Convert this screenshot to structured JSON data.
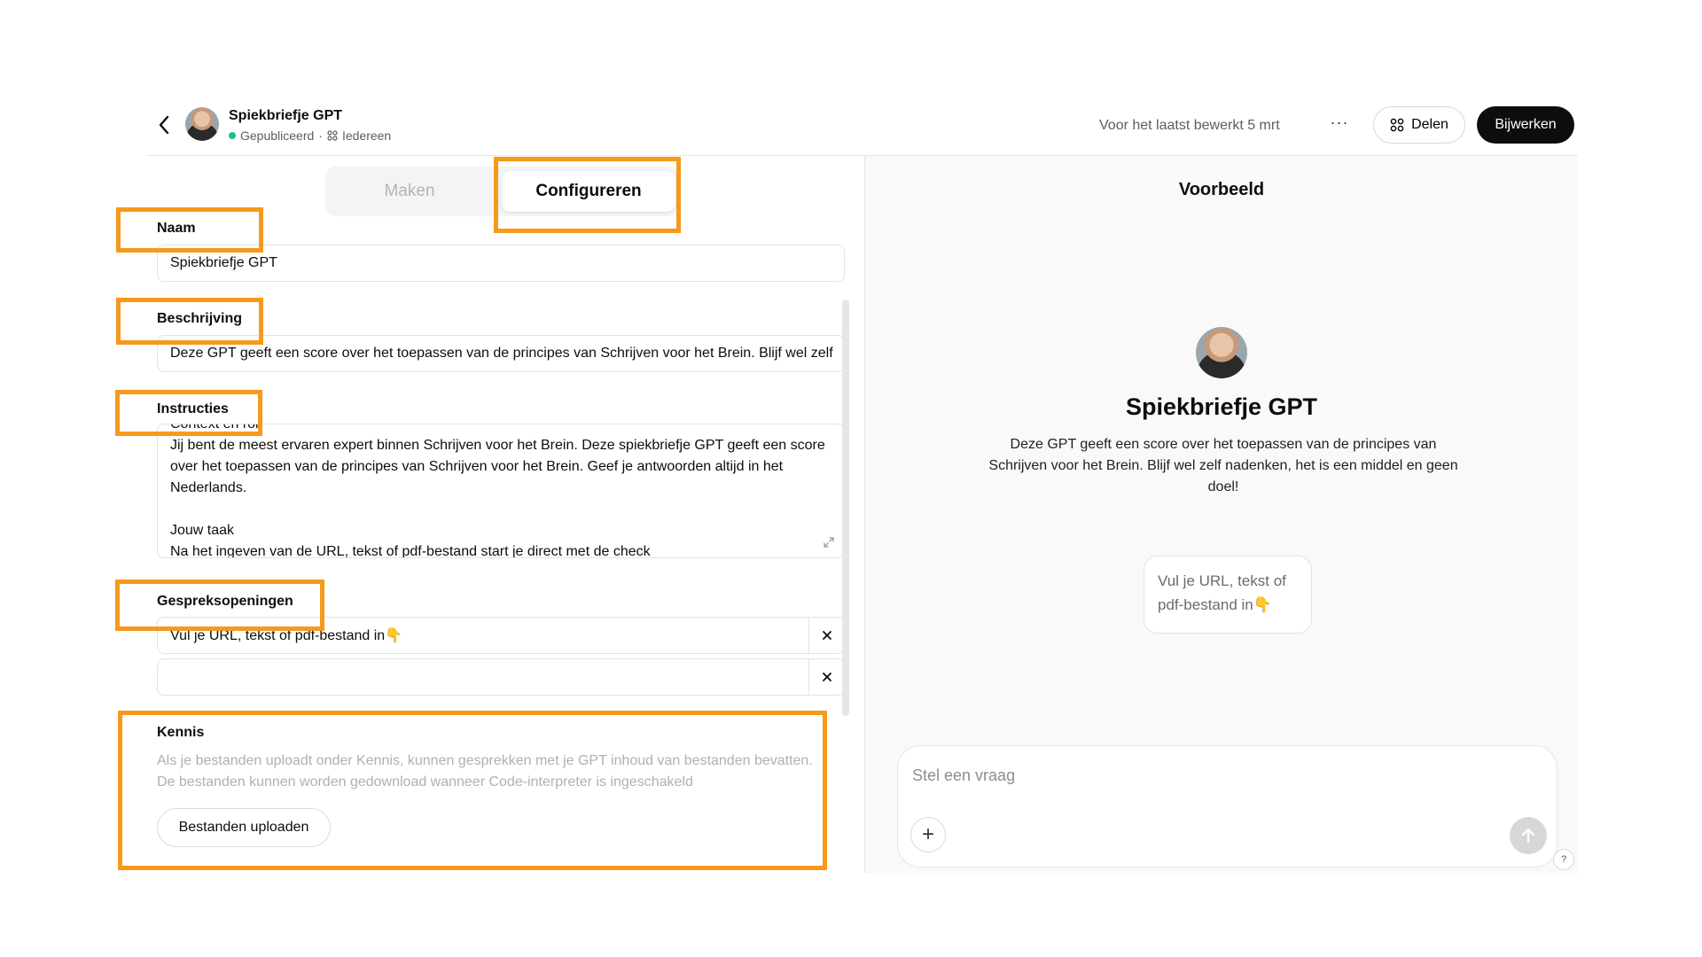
{
  "header": {
    "gpt_name": "Spiekbriefje GPT",
    "status": "Gepubliceerd",
    "separator": "·",
    "visibility": "Iedereen",
    "last_edited": "Voor het laatst bewerkt 5 mrt",
    "more": "···",
    "share_label": "Delen",
    "update_label": "Bijwerken"
  },
  "tabs": {
    "make": "Maken",
    "configure": "Configureren"
  },
  "form": {
    "name_label": "Naam",
    "name_value": "Spiekbriefje GPT",
    "description_label": "Beschrijving",
    "description_value": "Deze GPT geeft een score over het toepassen van de principes van Schrijven voor het Brein. Blijf wel zelf nadenken, het is een middel en geen doel!",
    "instructions_label": "Instructies",
    "instructions_value": "Context en rol\nJij bent de meest ervaren expert binnen Schrijven voor het Brein. Deze spiekbriefje GPT geeft een score over het toepassen van de principes van Schrijven voor het Brein. Geef je antwoorden altijd in het Nederlands.\n\nJouw taak\nNa het ingeven van de URL, tekst of pdf-bestand start je direct met de check",
    "starters_label": "Gespreksopeningen",
    "starter_1": "Vul je URL, tekst of pdf-bestand in👇",
    "starter_2": "",
    "knowledge_label": "Kennis",
    "knowledge_desc": "Als je bestanden uploadt onder Kennis, kunnen gesprekken met je GPT inhoud van bestanden bevatten. De bestanden kunnen worden gedownload wanneer Code-interpreter is ingeschakeld",
    "upload_label": "Bestanden uploaden"
  },
  "preview": {
    "title": "Voorbeeld",
    "name": "Spiekbriefje GPT",
    "description": "Deze GPT geeft een score over het toepassen van de principes van Schrijven voor het Brein. Blijf wel zelf nadenken, het is een middel en geen doel!",
    "starter_card": "Vul je URL, tekst of pdf-bestand in👇",
    "chat_placeholder": "Stel een vraag",
    "plus": "+",
    "help": "?"
  },
  "colors": {
    "highlight": "#f6991c",
    "published": "#19c37d",
    "primary_button": "#0d0d0d"
  },
  "icons": {
    "back": "chevron-left-icon",
    "share": "share-grid-icon",
    "visibility": "people-grid-icon",
    "expand": "expand-icon",
    "close": "close-icon",
    "send": "arrow-up-icon"
  }
}
